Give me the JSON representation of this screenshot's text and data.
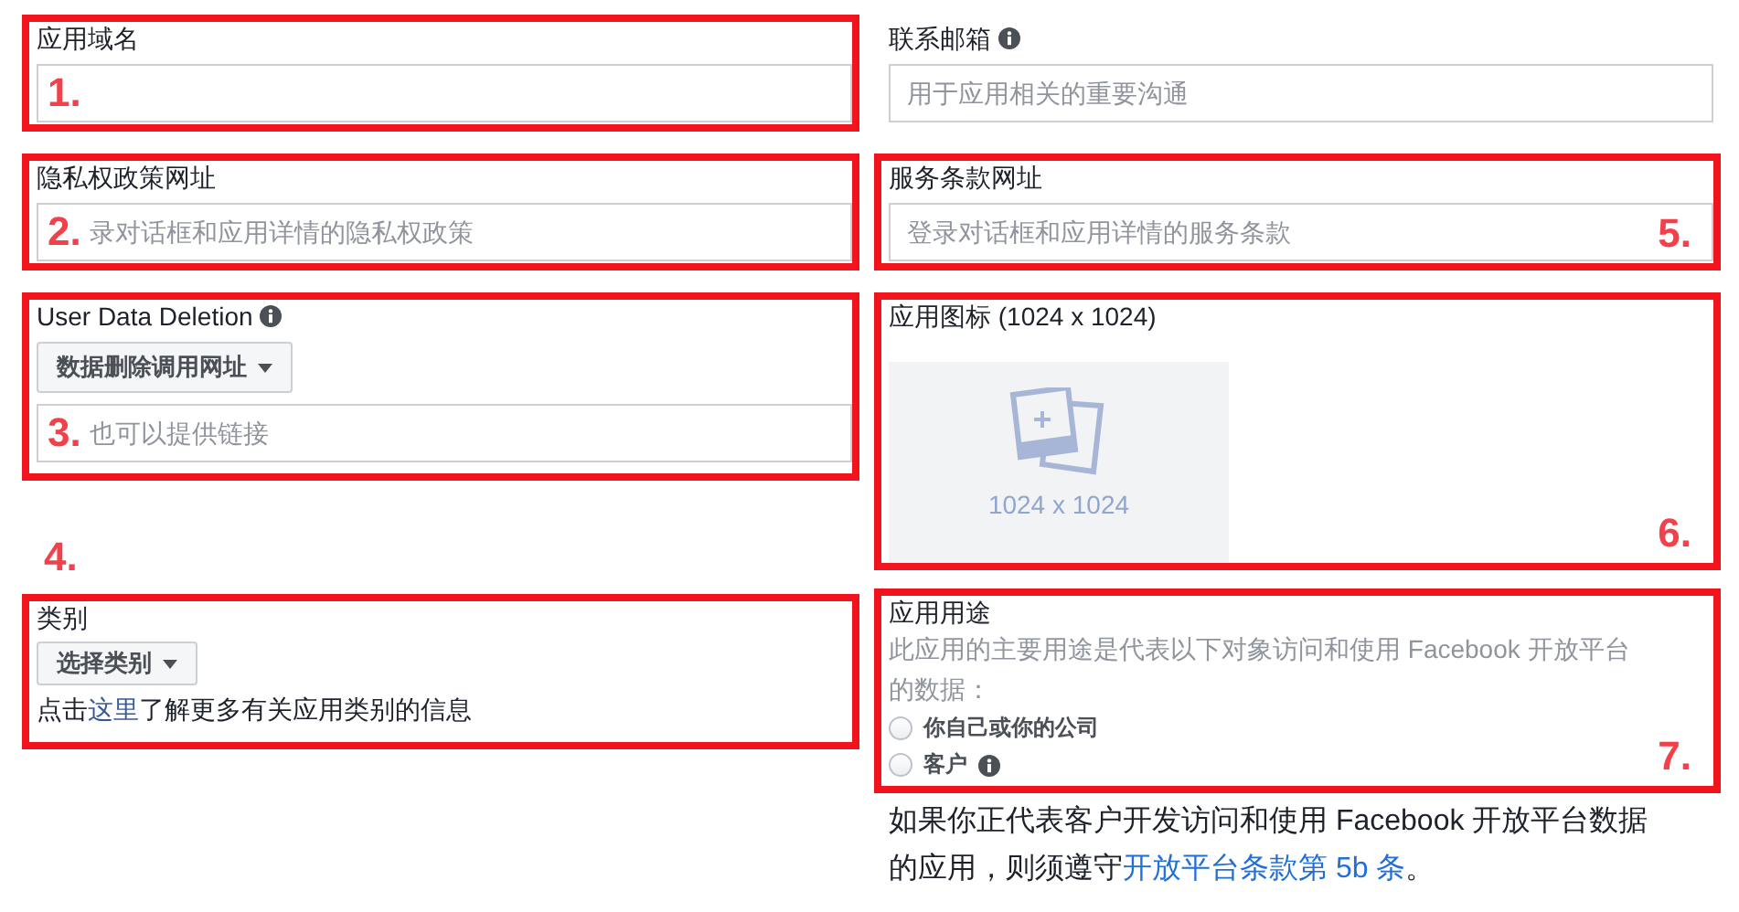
{
  "left": [
    {
      "kind": "text_field",
      "label": "应用域名",
      "info": false,
      "annotation": "1."
    },
    {
      "kind": "text_field",
      "label": "隐私权政策网址",
      "info": false,
      "placeholder": "录对话框和应用详情的隐私权政策",
      "annotation": "2."
    },
    {
      "kind": "deletion",
      "label": "User Data Deletion",
      "info": true,
      "dropdown": "数据删除调用网址",
      "placeholder": "也可以提供链接",
      "annotation": "3."
    },
    {
      "kind": "category",
      "label": "类别",
      "dropdown": "选择类别",
      "help_before": "点击",
      "help_link": "这里",
      "help_after": "了解更多有关应用类别的信息",
      "annotation": "4."
    }
  ],
  "right": [
    {
      "kind": "text_field",
      "label": "联系邮箱",
      "info": true,
      "placeholder": "用于应用相关的重要沟通"
    },
    {
      "kind": "text_field",
      "label": "服务条款网址",
      "info": false,
      "placeholder": "登录对话框和应用详情的服务条款",
      "annotation": "5."
    },
    {
      "kind": "icon_upload",
      "label": "应用图标 (1024 x 1024)",
      "size_text": "1024 x 1024",
      "annotation": "6."
    },
    {
      "kind": "radio_group",
      "label": "应用用途",
      "description": "此应用的主要用途是代表以下对象访问和使用 Facebook 开放平台的数据：",
      "options": [
        {
          "label": "你自己或你的公司",
          "selected": false,
          "info": false
        },
        {
          "label": "客户",
          "selected": false,
          "info": true
        }
      ],
      "annotation": "7."
    },
    {
      "kind": "note",
      "text_before": "如果你正代表客户开发访问和使用 Facebook 开放平台数据的应用，则须遵守",
      "link": "开放平台条款第 5b 条",
      "text_after": "。"
    }
  ]
}
